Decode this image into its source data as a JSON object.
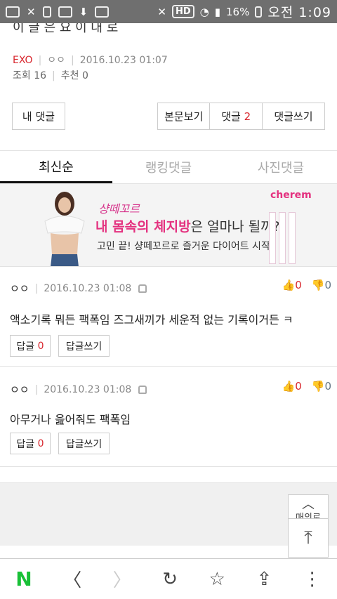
{
  "status": {
    "battery": "16%",
    "time": "오전 1:09",
    "hd": "HD"
  },
  "post": {
    "cut_title": "이 글 은 요 이 대 로",
    "author": "EXO",
    "nickname": "ㅇㅇ",
    "date": "2016.10.23 01:07",
    "views_label": "조회 16",
    "recommend_label": "추천 0"
  },
  "actions": {
    "my_comments": "내 댓글",
    "view_post": "본문보기",
    "comments_label": "댓글",
    "comments_count": "2",
    "write_comment": "댓글쓰기"
  },
  "tabs": [
    "최신순",
    "랭킹댓글",
    "사진댓글"
  ],
  "ad": {
    "script": "샹떼꼬르",
    "headline_pink": "내 몸속의 체지방",
    "headline_dark": "은 얼마나 될까?",
    "subline": "고민 끝! 샹떼꼬르로 즐거운 다이어트 시작",
    "brand": "cherem"
  },
  "comments": [
    {
      "nick": "ㅇㅇ",
      "date": "2016.10.23 01:08",
      "up": "0",
      "down": "0",
      "text": "액소기록 뭐든 팩폭임 즈그새끼가 세운적 없는 기록이거든 ㅋ",
      "reply_label": "답글",
      "reply_count": "0",
      "write_reply": "답글쓰기"
    },
    {
      "nick": "ㅇㅇ",
      "date": "2016.10.23 01:08",
      "up": "0",
      "down": "0",
      "text": "아무거나 읊어줘도 팩폭임",
      "reply_label": "답글",
      "reply_count": "0",
      "write_reply": "답글쓰기"
    }
  ],
  "fab": {
    "more_label": "매의로"
  },
  "nav": {
    "n": "N",
    "back": "〈",
    "forward": "〉",
    "reload": "↻",
    "star": "☆",
    "share": "⇪",
    "menu": "⋮"
  }
}
